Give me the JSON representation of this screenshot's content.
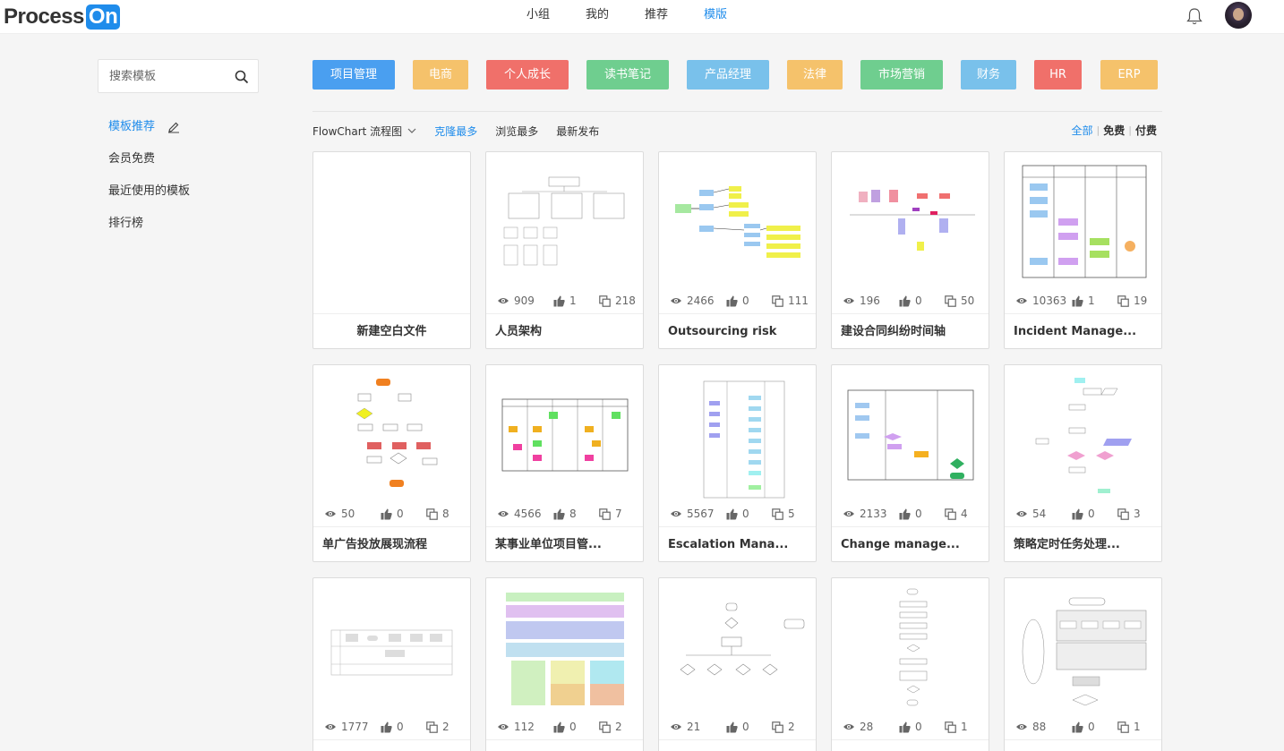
{
  "header": {
    "logo_text": "Process",
    "logo_on": "On",
    "nav": [
      "小组",
      "我的",
      "推荐",
      "模版"
    ],
    "active_nav": 3,
    "icons": [
      "bell-icon",
      "avatar"
    ]
  },
  "sidebar": {
    "search_placeholder": "搜索模板",
    "items": [
      "模板推荐",
      "会员免费",
      "最近使用的模板",
      "排行榜"
    ],
    "active_item": 0
  },
  "categories": [
    {
      "label": "项目管理",
      "color": "#4a9ff0"
    },
    {
      "label": "电商",
      "color": "#f5c26b"
    },
    {
      "label": "个人成长",
      "color": "#f0706a"
    },
    {
      "label": "读书笔记",
      "color": "#6fce8f"
    },
    {
      "label": "产品经理",
      "color": "#79c1eb"
    },
    {
      "label": "法律",
      "color": "#f5c26b"
    },
    {
      "label": "市场营销",
      "color": "#6fce8f"
    },
    {
      "label": "财务",
      "color": "#79c1eb"
    },
    {
      "label": "HR",
      "color": "#f0706a"
    },
    {
      "label": "ERP",
      "color": "#f5c26b"
    }
  ],
  "filters": {
    "type": "FlowChart 流程图",
    "sorts": [
      "克隆最多",
      "浏览最多",
      "最新发布"
    ],
    "active_sort": 0,
    "price": [
      "全部",
      "免费",
      "付费"
    ],
    "active_price": 0
  },
  "cards": [
    {
      "name": "新建空白文件",
      "blank": true
    },
    {
      "name": "人员架构",
      "views": "909",
      "likes": "1",
      "clones": "218",
      "thumb": "org"
    },
    {
      "name": "Outsourcing risk",
      "views": "2466",
      "likes": "0",
      "clones": "111",
      "thumb": "mind"
    },
    {
      "name": "建设合同纠纷时间轴",
      "views": "196",
      "likes": "0",
      "clones": "50",
      "thumb": "timeline"
    },
    {
      "name": "Incident Manage...",
      "views": "10363",
      "likes": "1",
      "clones": "19",
      "thumb": "swim"
    },
    {
      "name": "单广告投放展现流程",
      "views": "50",
      "likes": "0",
      "clones": "8",
      "thumb": "flow1"
    },
    {
      "name": "某事业单位项目管...",
      "views": "4566",
      "likes": "8",
      "clones": "7",
      "thumb": "swim2"
    },
    {
      "name": "Escalation Mana...",
      "views": "5567",
      "likes": "0",
      "clones": "5",
      "thumb": "swim3"
    },
    {
      "name": "Change manage...",
      "views": "2133",
      "likes": "0",
      "clones": "4",
      "thumb": "swim4"
    },
    {
      "name": "策略定时任务处理...",
      "views": "54",
      "likes": "0",
      "clones": "3",
      "thumb": "flow2"
    },
    {
      "name": "",
      "views": "1777",
      "likes": "0",
      "clones": "2",
      "thumb": "lanes"
    },
    {
      "name": "",
      "views": "112",
      "likes": "0",
      "clones": "2",
      "thumb": "arch"
    },
    {
      "name": "",
      "views": "21",
      "likes": "0",
      "clones": "2",
      "thumb": "tree"
    },
    {
      "name": "",
      "views": "28",
      "likes": "0",
      "clones": "1",
      "thumb": "vflow"
    },
    {
      "name": "",
      "views": "88",
      "likes": "0",
      "clones": "1",
      "thumb": "proc"
    }
  ]
}
